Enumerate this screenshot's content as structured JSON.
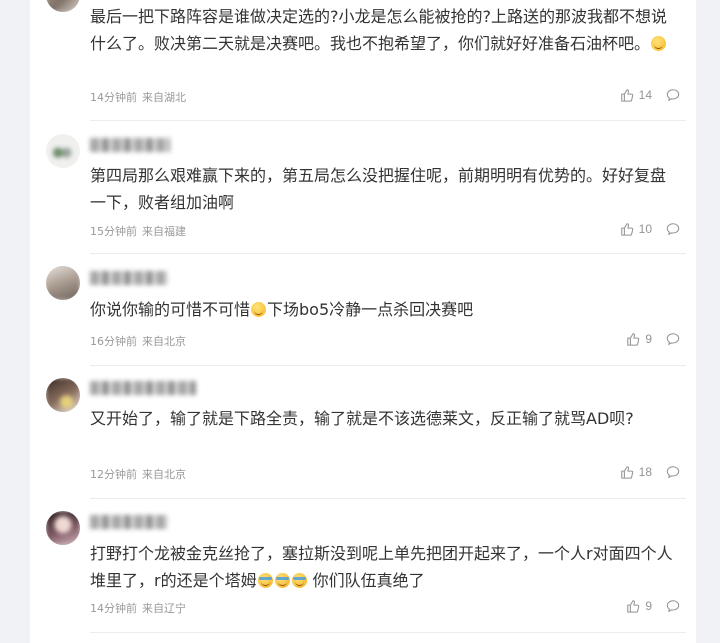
{
  "comments": [
    {
      "text_1": "最后一把下路阵容是谁做决定选的?小龙是怎么能被抢的?上路送的那波我都不想说什么了。败决第二天就是决赛吧。我也不抱希望了，你们就好好准备石油杯吧。",
      "time": "14分钟前",
      "location": "来自湖北",
      "likes": "14",
      "emoji": "smile"
    },
    {
      "text_1": "第四局那么艰难赢下来的，第五局怎么没把握住呢，前期明明有优势的。好好复盘一下，败者组加油啊",
      "time": "15分钟前",
      "location": "来自福建",
      "likes": "10"
    },
    {
      "text_1": "你说你输的可惜不可惜",
      "text_2": "下场bo5冷静一点杀回决赛吧",
      "time": "16分钟前",
      "location": "来自北京",
      "likes": "9",
      "emoji": "smile"
    },
    {
      "text_1": "又开始了，输了就是下路全责，输了就是不该选德莱文，反正输了就骂AD呗?",
      "time": "12分钟前",
      "location": "来自北京",
      "likes": "18"
    },
    {
      "text_1": "打野打个龙被金克丝抢了，塞拉斯没到呢上单先把团开起来了，一个人r对面四个人堆里了，r的还是个塔姆",
      "text_2": " 你们队伍真绝了",
      "time": "14分钟前",
      "location": "来自辽宁",
      "likes": "9",
      "emoji": "sweat x3"
    }
  ],
  "icons": {
    "like": "thumbs-up-icon",
    "reply": "comment-bubble-icon"
  },
  "colors": {
    "page_bg": "#f1f2f5",
    "card_bg": "#ffffff",
    "text": "#333333",
    "meta": "#999999",
    "icon": "#939393"
  }
}
